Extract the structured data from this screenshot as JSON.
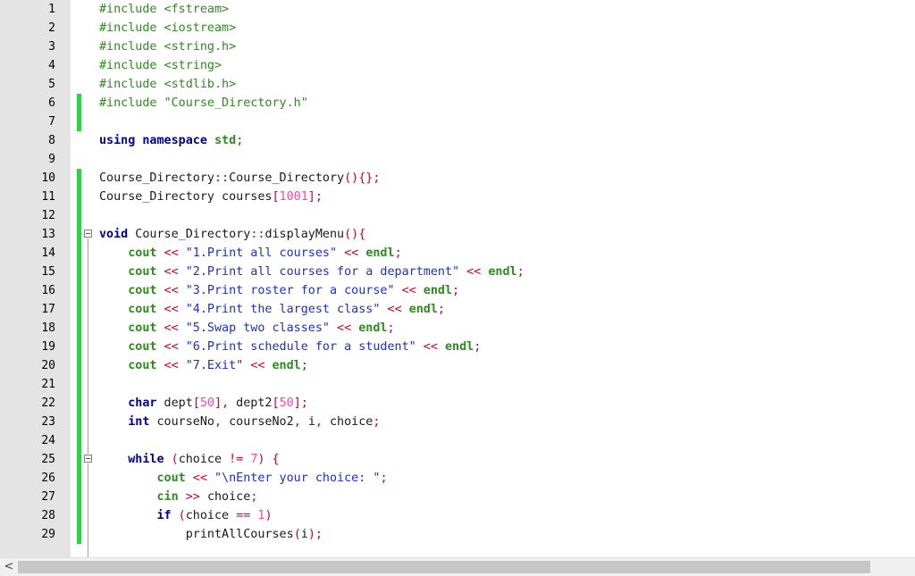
{
  "editor": {
    "lines": [
      {
        "n": "1",
        "changed": false,
        "tokens": [
          [
            "#include <fstream>",
            "pre"
          ]
        ]
      },
      {
        "n": "2",
        "changed": false,
        "tokens": [
          [
            "#include <iostream>",
            "pre"
          ]
        ]
      },
      {
        "n": "3",
        "changed": false,
        "tokens": [
          [
            "#include <string.h>",
            "pre"
          ]
        ]
      },
      {
        "n": "4",
        "changed": false,
        "tokens": [
          [
            "#include <string>",
            "pre"
          ]
        ]
      },
      {
        "n": "5",
        "changed": false,
        "tokens": [
          [
            "#include <stdlib.h>",
            "pre"
          ]
        ]
      },
      {
        "n": "6",
        "changed": true,
        "tokens": [
          [
            "#include \"Course_Directory.h\"",
            "pre"
          ]
        ]
      },
      {
        "n": "7",
        "changed": true,
        "tokens": []
      },
      {
        "n": "8",
        "changed": false,
        "tokens": [
          [
            "using namespace ",
            "kw"
          ],
          [
            "std",
            "lib"
          ],
          [
            ";",
            "op"
          ]
        ]
      },
      {
        "n": "9",
        "changed": false,
        "tokens": []
      },
      {
        "n": "10",
        "changed": true,
        "tokens": [
          [
            "Course_Directory",
            "id"
          ],
          [
            "::",
            "op"
          ],
          [
            "Course_Directory",
            "id"
          ],
          [
            "(){};",
            "op"
          ]
        ]
      },
      {
        "n": "11",
        "changed": true,
        "tokens": [
          [
            "Course_Directory courses",
            "id"
          ],
          [
            "[",
            "op"
          ],
          [
            "1001",
            "num"
          ],
          [
            "];",
            "op"
          ]
        ]
      },
      {
        "n": "12",
        "changed": true,
        "tokens": []
      },
      {
        "n": "13",
        "changed": true,
        "fold": true,
        "tokens": [
          [
            "void",
            "type"
          ],
          [
            " Course_Directory",
            "id"
          ],
          [
            "::",
            "op"
          ],
          [
            "displayMenu",
            "id"
          ],
          [
            "(){",
            "op"
          ]
        ]
      },
      {
        "n": "14",
        "changed": true,
        "tokens": [
          [
            "    "
          ],
          [
            "cout",
            "lib"
          ],
          [
            " << ",
            "op"
          ],
          [
            "\"1.Print all courses\"",
            "str"
          ],
          [
            " << ",
            "op"
          ],
          [
            "endl",
            "lib"
          ],
          [
            ";",
            "op"
          ]
        ]
      },
      {
        "n": "15",
        "changed": true,
        "tokens": [
          [
            "    "
          ],
          [
            "cout",
            "lib"
          ],
          [
            " << ",
            "op"
          ],
          [
            "\"2.Print all courses for a department\"",
            "str"
          ],
          [
            " << ",
            "op"
          ],
          [
            "endl",
            "lib"
          ],
          [
            ";",
            "op"
          ]
        ]
      },
      {
        "n": "16",
        "changed": true,
        "tokens": [
          [
            "    "
          ],
          [
            "cout",
            "lib"
          ],
          [
            " << ",
            "op"
          ],
          [
            "\"3.Print roster for a course\"",
            "str"
          ],
          [
            " << ",
            "op"
          ],
          [
            "endl",
            "lib"
          ],
          [
            ";",
            "op"
          ]
        ]
      },
      {
        "n": "17",
        "changed": true,
        "tokens": [
          [
            "    "
          ],
          [
            "cout",
            "lib"
          ],
          [
            " << ",
            "op"
          ],
          [
            "\"4.Print the largest class\"",
            "str"
          ],
          [
            " << ",
            "op"
          ],
          [
            "endl",
            "lib"
          ],
          [
            ";",
            "op"
          ]
        ]
      },
      {
        "n": "18",
        "changed": true,
        "tokens": [
          [
            "    "
          ],
          [
            "cout",
            "lib"
          ],
          [
            " << ",
            "op"
          ],
          [
            "\"5.Swap two classes\"",
            "str"
          ],
          [
            " << ",
            "op"
          ],
          [
            "endl",
            "lib"
          ],
          [
            ";",
            "op"
          ]
        ]
      },
      {
        "n": "19",
        "changed": true,
        "tokens": [
          [
            "    "
          ],
          [
            "cout",
            "lib"
          ],
          [
            " << ",
            "op"
          ],
          [
            "\"6.Print schedule for a student\"",
            "str"
          ],
          [
            " << ",
            "op"
          ],
          [
            "endl",
            "lib"
          ],
          [
            ";",
            "op"
          ]
        ]
      },
      {
        "n": "20",
        "changed": true,
        "tokens": [
          [
            "    "
          ],
          [
            "cout",
            "lib"
          ],
          [
            " << ",
            "op"
          ],
          [
            "\"7.Exit\"",
            "str"
          ],
          [
            " << ",
            "op"
          ],
          [
            "endl",
            "lib"
          ],
          [
            ";",
            "op"
          ]
        ]
      },
      {
        "n": "21",
        "changed": true,
        "tokens": []
      },
      {
        "n": "22",
        "changed": true,
        "tokens": [
          [
            "    "
          ],
          [
            "char",
            "type"
          ],
          [
            " dept",
            "id"
          ],
          [
            "[",
            "op"
          ],
          [
            "50",
            "num"
          ],
          [
            "],",
            "op"
          ],
          [
            " dept2",
            "id"
          ],
          [
            "[",
            "op"
          ],
          [
            "50",
            "num"
          ],
          [
            "];",
            "op"
          ]
        ]
      },
      {
        "n": "23",
        "changed": true,
        "tokens": [
          [
            "    "
          ],
          [
            "int",
            "type"
          ],
          [
            " courseNo",
            "id"
          ],
          [
            ", ",
            "op"
          ],
          [
            "courseNo2",
            "id"
          ],
          [
            ", ",
            "op"
          ],
          [
            "i",
            "id"
          ],
          [
            ", ",
            "op"
          ],
          [
            "choice",
            "id"
          ],
          [
            ";",
            "op"
          ]
        ]
      },
      {
        "n": "24",
        "changed": true,
        "tokens": []
      },
      {
        "n": "25",
        "changed": true,
        "fold": true,
        "tokens": [
          [
            "    "
          ],
          [
            "while",
            "type"
          ],
          [
            " (",
            "op"
          ],
          [
            "choice ",
            "id"
          ],
          [
            "!=",
            "op"
          ],
          [
            " ",
            "id"
          ],
          [
            "7",
            "num"
          ],
          [
            ") {",
            "op"
          ]
        ]
      },
      {
        "n": "26",
        "changed": true,
        "tokens": [
          [
            "        "
          ],
          [
            "cout",
            "lib"
          ],
          [
            " << ",
            "op"
          ],
          [
            "\"\\nEnter your choice: \"",
            "str"
          ],
          [
            ";",
            "op"
          ]
        ]
      },
      {
        "n": "27",
        "changed": true,
        "tokens": [
          [
            "        "
          ],
          [
            "cin",
            "lib"
          ],
          [
            " >> ",
            "op"
          ],
          [
            "choice",
            "id"
          ],
          [
            ";",
            "op"
          ]
        ]
      },
      {
        "n": "28",
        "changed": true,
        "tokens": [
          [
            "        "
          ],
          [
            "if",
            "type"
          ],
          [
            " (",
            "op"
          ],
          [
            "choice ",
            "id"
          ],
          [
            "==",
            "op"
          ],
          [
            " ",
            "id"
          ],
          [
            "1",
            "num"
          ],
          [
            ")",
            "op"
          ]
        ]
      },
      {
        "n": "29",
        "changed": true,
        "tokens": [
          [
            "            "
          ],
          [
            "printAllCourses",
            "id"
          ],
          [
            "(",
            "op"
          ],
          [
            "i",
            "id"
          ],
          [
            ");",
            "op"
          ]
        ]
      }
    ]
  },
  "scrollbar": {
    "left_arrow": "<"
  }
}
